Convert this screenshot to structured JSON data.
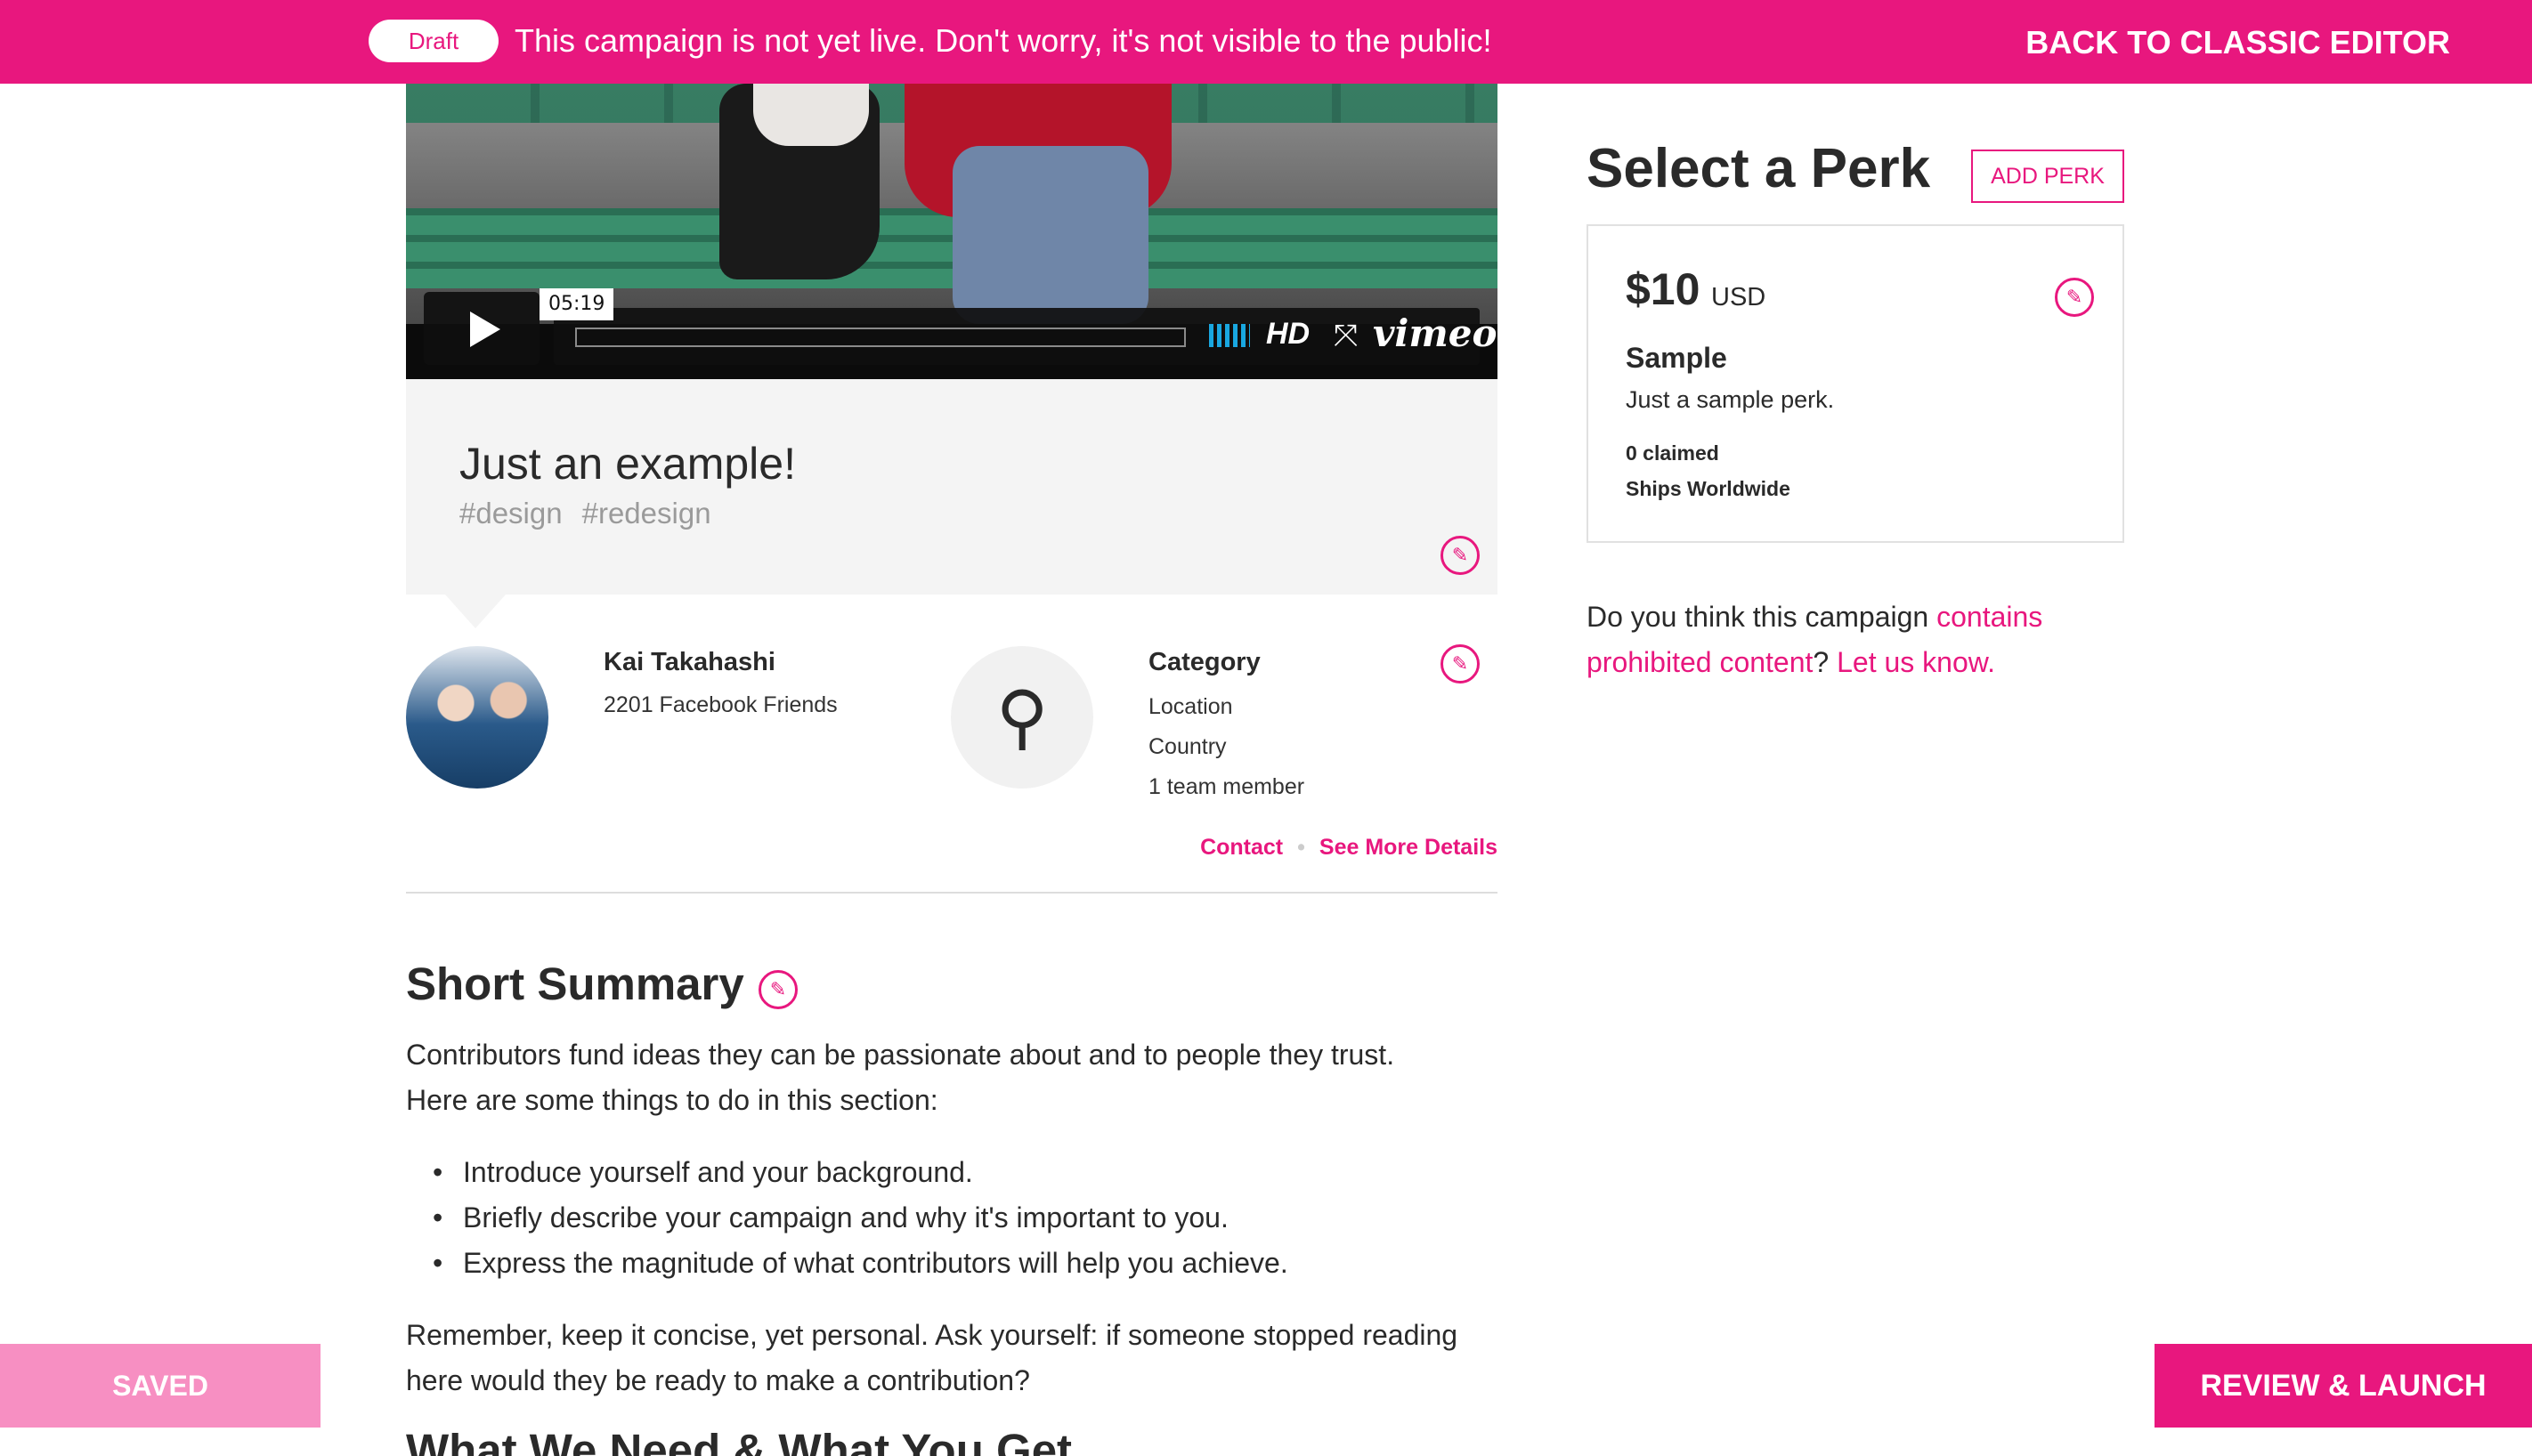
{
  "draft_bar": {
    "badge": "Draft",
    "message": "This campaign is not yet live. Don't worry, it's not visible to the public!",
    "classic_editor_label": "BACK TO CLASSIC EDITOR"
  },
  "video": {
    "timecode": "05:19",
    "hd_label": "HD",
    "brand": "vimeo",
    "volume_icon": "volume-bars-icon",
    "fullscreen_icon": "fullscreen-icon",
    "play_icon": "play-icon",
    "volume_color": "#19a7e0"
  },
  "campaign": {
    "title": "Just an example!",
    "tags": [
      "#design",
      "#redesign"
    ]
  },
  "owner": {
    "name": "Kai Takahashi",
    "friends": "2201 Facebook Friends"
  },
  "category": {
    "label": "Category",
    "lines": [
      "Location",
      "Country",
      "1 team member"
    ],
    "icon": "lightbulb-icon"
  },
  "links": {
    "contact": "Contact",
    "separator": "•",
    "more_details": "See More Details"
  },
  "summary": {
    "heading": "Short Summary",
    "intro_line1": "Contributors fund ideas they can be passionate about and to people they trust.",
    "intro_line2": "Here are some things to do in this section:",
    "bullets": [
      "Introduce yourself and your background.",
      "Briefly describe your campaign and why it's important to you.",
      "Express the magnitude of what contributors will help you achieve."
    ],
    "outro_line1": "Remember, keep it concise, yet personal. Ask yourself: if someone stopped reading",
    "outro_line2": "here would they be ready to make a contribution?",
    "next_heading": "What We Need & What You Get"
  },
  "perks": {
    "heading": "Select a Perk",
    "add_label": "ADD PERK",
    "card": {
      "price": "$10",
      "currency": "USD",
      "title": "Sample",
      "description": "Just a sample perk.",
      "claimed": "0 claimed",
      "shipping": "Ships Worldwide"
    }
  },
  "report": {
    "prefix": "Do you think this campaign",
    "link1": "contains prohibited content",
    "middle": "?",
    "link2": "Let us know."
  },
  "actions": {
    "saved_label": "SAVED",
    "launch_label": "REVIEW & LAUNCH"
  },
  "colors": {
    "accent": "#e8177e",
    "saved_bg": "#f78fc2",
    "title_box_bg": "#f4f4f4"
  }
}
